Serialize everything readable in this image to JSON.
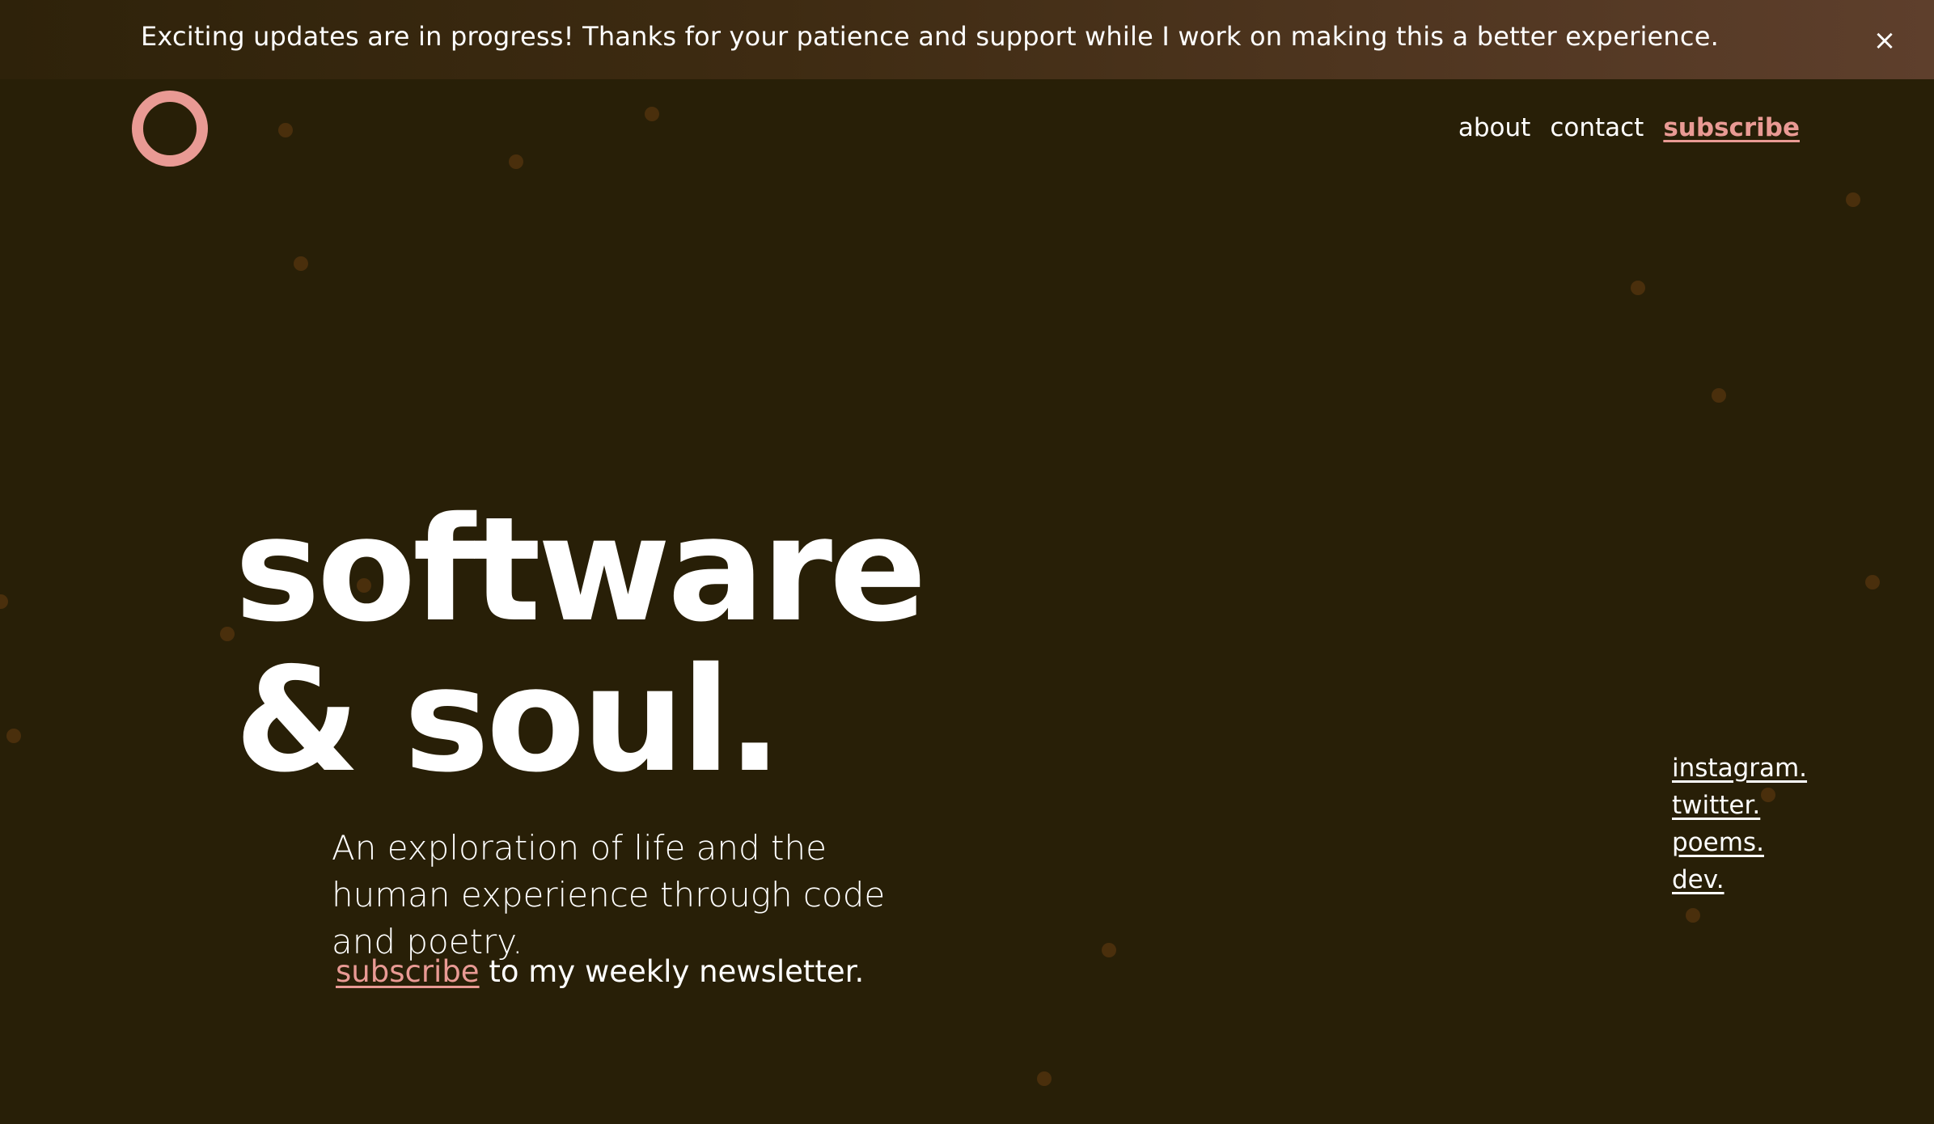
{
  "banner": {
    "message": "Exciting updates are in progress! Thanks for your patience and support while I work on making this a better experience.",
    "close_label": "×"
  },
  "nav": {
    "about": "about",
    "contact": "contact",
    "subscribe": "subscribe"
  },
  "hero": {
    "title_line1": "software",
    "title_line2": "& soul.",
    "tagline": "An exploration of life and the human experience through code and poetry."
  },
  "newsletter": {
    "link": "subscribe",
    "text": " to my weekly newsletter."
  },
  "social": {
    "instagram": "instagram.",
    "twitter": "twitter.",
    "poems": "poems.",
    "dev": "dev."
  },
  "colors": {
    "background": "#281f07",
    "accent": "#e99a94",
    "dot": "#4a2f0c"
  }
}
